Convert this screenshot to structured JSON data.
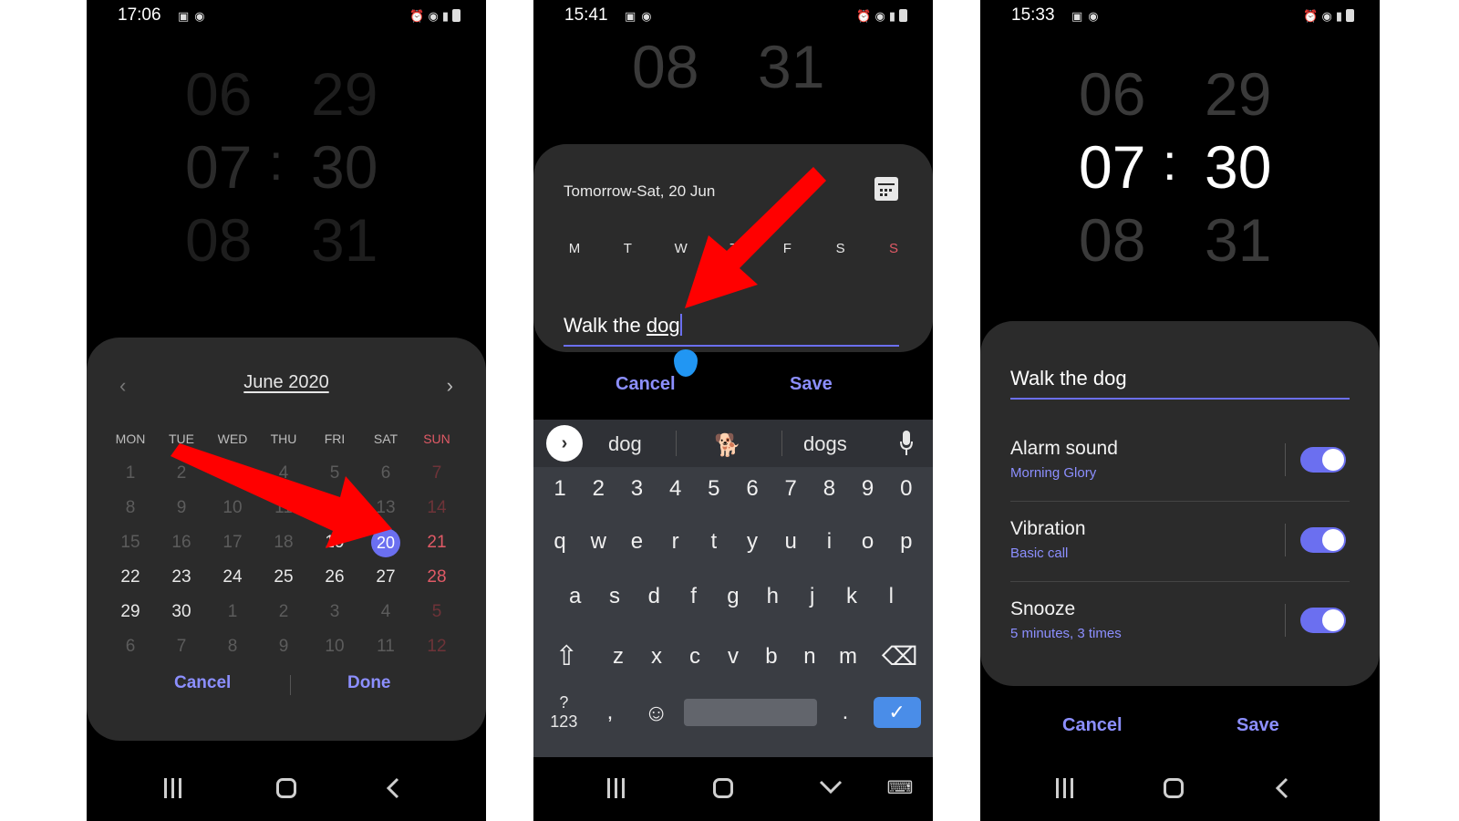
{
  "phone1": {
    "status": {
      "time": "17:06"
    },
    "time_picker": {
      "hours_above": "06",
      "hours": "07",
      "hours_below": "08",
      "separator": ":",
      "minutes_above": "29",
      "minutes": "30",
      "minutes_below": "31"
    },
    "calendar": {
      "month_label": "June 2020",
      "prev_glyph": "‹",
      "next_glyph": "›",
      "weekdays": [
        "MON",
        "TUE",
        "WED",
        "THU",
        "FRI",
        "SAT",
        "SUN"
      ],
      "weeks": [
        [
          "1",
          "2",
          "3",
          "4",
          "5",
          "6",
          "7"
        ],
        [
          "8",
          "9",
          "10",
          "11",
          "12",
          "13",
          "14"
        ],
        [
          "15",
          "16",
          "17",
          "18",
          "19",
          "20",
          "21"
        ],
        [
          "22",
          "23",
          "24",
          "25",
          "26",
          "27",
          "28"
        ],
        [
          "29",
          "30",
          "1",
          "2",
          "3",
          "4",
          "5"
        ],
        [
          "6",
          "7",
          "8",
          "9",
          "10",
          "11",
          "12"
        ]
      ],
      "selected_day": "20",
      "cancel_label": "Cancel",
      "done_label": "Done"
    }
  },
  "phone2": {
    "status": {
      "time": "15:41"
    },
    "time_picker": {
      "hours_below": "08",
      "minutes_below": "31"
    },
    "date_label": "Tomorrow-Sat, 20 Jun",
    "weekdays": [
      "M",
      "T",
      "W",
      "T",
      "F",
      "S",
      "S"
    ],
    "alarm_name_prefix": "Walk the ",
    "alarm_name_word": "dog",
    "cancel_label": "Cancel",
    "save_label": "Save",
    "keyboard": {
      "suggestion_1": "dog",
      "suggestion_emoji": "🐕",
      "suggestion_3": "dogs",
      "row_numbers": [
        "1",
        "2",
        "3",
        "4",
        "5",
        "6",
        "7",
        "8",
        "9",
        "0"
      ],
      "row_1": [
        "q",
        "w",
        "e",
        "r",
        "t",
        "y",
        "u",
        "i",
        "o",
        "p"
      ],
      "row_2": [
        "a",
        "s",
        "d",
        "f",
        "g",
        "h",
        "j",
        "k",
        "l"
      ],
      "row_3": [
        "z",
        "x",
        "c",
        "v",
        "b",
        "n",
        "m"
      ],
      "symbols_label": "?123",
      "comma_label": ",",
      "period_label": ".",
      "emoji_glyph": "☺",
      "enter_glyph": "✓",
      "shift_glyph": "⇧",
      "backspace_glyph": "⌫"
    }
  },
  "phone3": {
    "status": {
      "time": "15:33"
    },
    "time_picker": {
      "hours_above": "06",
      "hours": "07",
      "hours_below": "08",
      "separator": ":",
      "minutes_above": "29",
      "minutes": "30",
      "minutes_below": "31"
    },
    "alarm_name": "Walk the dog",
    "settings": [
      {
        "title": "Alarm sound",
        "subtitle": "Morning Glory",
        "enabled": true
      },
      {
        "title": "Vibration",
        "subtitle": "Basic call",
        "enabled": true
      },
      {
        "title": "Snooze",
        "subtitle": "5 minutes, 3 times",
        "enabled": true
      }
    ],
    "cancel_label": "Cancel",
    "save_label": "Save"
  },
  "colors": {
    "accent": "#8c8fff",
    "selected": "#6b6ff0",
    "sunday": "#e05a66",
    "annotation_arrow": "#ff0000",
    "enter_key": "#4a8de8"
  },
  "icons": [
    "image-icon",
    "wifi-icon",
    "alarm-icon",
    "signal-icon",
    "battery-icon",
    "calendar-icon",
    "mic-icon",
    "emoji-icon",
    "shift-icon",
    "backspace-icon",
    "recents-icon",
    "home-icon",
    "back-icon",
    "hide-keyboard-icon",
    "keyboard-icon",
    "chevron-right-icon"
  ]
}
